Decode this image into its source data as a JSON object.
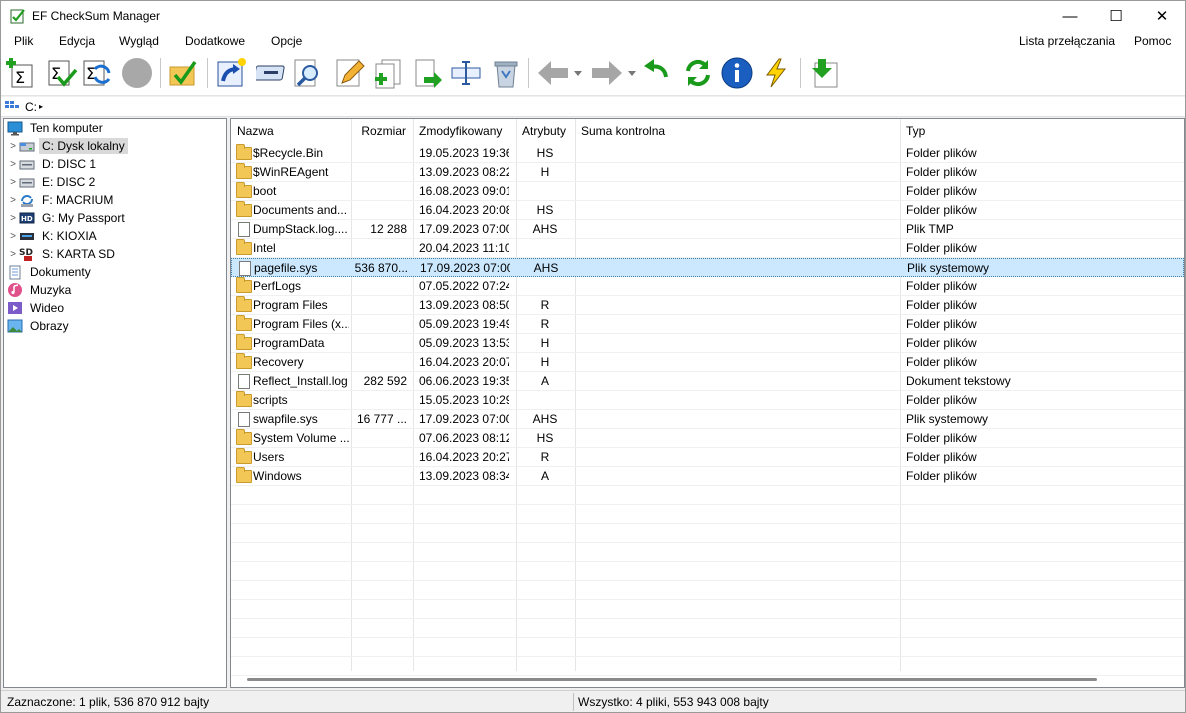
{
  "window": {
    "title": "EF CheckSum Manager",
    "minimize": "—",
    "maximize": "☐",
    "close": "✕"
  },
  "menu": {
    "items": [
      "Plik",
      "Edycja",
      "Wygląd",
      "Dodatkowe",
      "Opcje"
    ],
    "right": [
      "Lista przełączania",
      "Pomoc"
    ]
  },
  "toolbar": {
    "icons": [
      "add-checksum-icon",
      "verify-checksum-icon",
      "update-checksum-icon",
      "stop-icon",
      "check-folder-icon",
      "shortcut-icon",
      "drive-icon",
      "search-icon",
      "edit-icon",
      "new-file-icon",
      "copy-to-icon",
      "rename-icon",
      "recycle-bin-icon",
      "back-arrow-icon",
      "forward-arrow-icon",
      "undo-icon",
      "refresh-icon",
      "info-icon",
      "lightning-icon",
      "download-icon"
    ]
  },
  "path": {
    "segment": "C:",
    "arrow": "▸"
  },
  "tree": {
    "root": "Ten komputer",
    "drives": [
      {
        "label": "C: Dysk lokalny",
        "selected": true
      },
      {
        "label": "D: DISC 1"
      },
      {
        "label": "E: DISC 2"
      },
      {
        "label": "F: MACRIUM"
      },
      {
        "label": "G: My Passport"
      },
      {
        "label": "K: KIOXIA"
      },
      {
        "label": "S: KARTA SD"
      }
    ],
    "libraries": [
      "Dokumenty",
      "Muzyka",
      "Wideo",
      "Obrazy"
    ]
  },
  "list": {
    "headers": {
      "name": "Nazwa",
      "size": "Rozmiar",
      "modified": "Zmodyfikowany",
      "attrs": "Atrybuty",
      "checksum": "Suma kontrolna",
      "type": "Typ"
    },
    "rows": [
      {
        "name": "$Recycle.Bin",
        "size": "",
        "date": "19.05.2023  19:36",
        "attr": "HS",
        "type": "Folder plików",
        "kind": "folder"
      },
      {
        "name": "$WinREAgent",
        "size": "",
        "date": "13.09.2023  08:22",
        "attr": "H",
        "type": "Folder plików",
        "kind": "folder"
      },
      {
        "name": "boot",
        "size": "",
        "date": "16.08.2023  09:01",
        "attr": "",
        "type": "Folder plików",
        "kind": "folder"
      },
      {
        "name": "Documents and...",
        "size": "",
        "date": "16.04.2023  20:08",
        "attr": "HS",
        "type": "Folder plików",
        "kind": "folder"
      },
      {
        "name": "DumpStack.log....",
        "size": "12 288",
        "date": "17.09.2023  07:00",
        "attr": "AHS",
        "type": "Plik TMP",
        "kind": "file"
      },
      {
        "name": "Intel",
        "size": "",
        "date": "20.04.2023  11:10",
        "attr": "",
        "type": "Folder plików",
        "kind": "folder"
      },
      {
        "name": "pagefile.sys",
        "size": "536 870...",
        "date": "17.09.2023  07:00",
        "attr": "AHS",
        "type": "Plik systemowy",
        "kind": "file",
        "selected": true
      },
      {
        "name": "PerfLogs",
        "size": "",
        "date": "07.05.2022  07:24",
        "attr": "",
        "type": "Folder plików",
        "kind": "folder"
      },
      {
        "name": "Program Files",
        "size": "",
        "date": "13.09.2023  08:50",
        "attr": "R",
        "type": "Folder plików",
        "kind": "folder"
      },
      {
        "name": "Program Files (x...",
        "size": "",
        "date": "05.09.2023  19:49",
        "attr": "R",
        "type": "Folder plików",
        "kind": "folder"
      },
      {
        "name": "ProgramData",
        "size": "",
        "date": "05.09.2023  13:53",
        "attr": "H",
        "type": "Folder plików",
        "kind": "folder"
      },
      {
        "name": "Recovery",
        "size": "",
        "date": "16.04.2023  20:07",
        "attr": "H",
        "type": "Folder plików",
        "kind": "folder"
      },
      {
        "name": "Reflect_Install.log",
        "size": "282 592",
        "date": "06.06.2023  19:35",
        "attr": "A",
        "type": "Dokument tekstowy",
        "kind": "file"
      },
      {
        "name": "scripts",
        "size": "",
        "date": "15.05.2023  10:29",
        "attr": "",
        "type": "Folder plików",
        "kind": "folder"
      },
      {
        "name": "swapfile.sys",
        "size": "16 777 ...",
        "date": "17.09.2023  07:00",
        "attr": "AHS",
        "type": "Plik systemowy",
        "kind": "file"
      },
      {
        "name": "System Volume ...",
        "size": "",
        "date": "07.06.2023  08:12",
        "attr": "HS",
        "type": "Folder plików",
        "kind": "folder"
      },
      {
        "name": "Users",
        "size": "",
        "date": "16.04.2023  20:27",
        "attr": "R",
        "type": "Folder plików",
        "kind": "folder"
      },
      {
        "name": "Windows",
        "size": "",
        "date": "13.09.2023  08:34",
        "attr": "A",
        "type": "Folder plików",
        "kind": "folder"
      }
    ]
  },
  "status": {
    "left": "Zaznaczone: 1 plik, 536 870 912 bajty",
    "right": "Wszystko: 4 pliki, 553 943 008 bajty"
  }
}
